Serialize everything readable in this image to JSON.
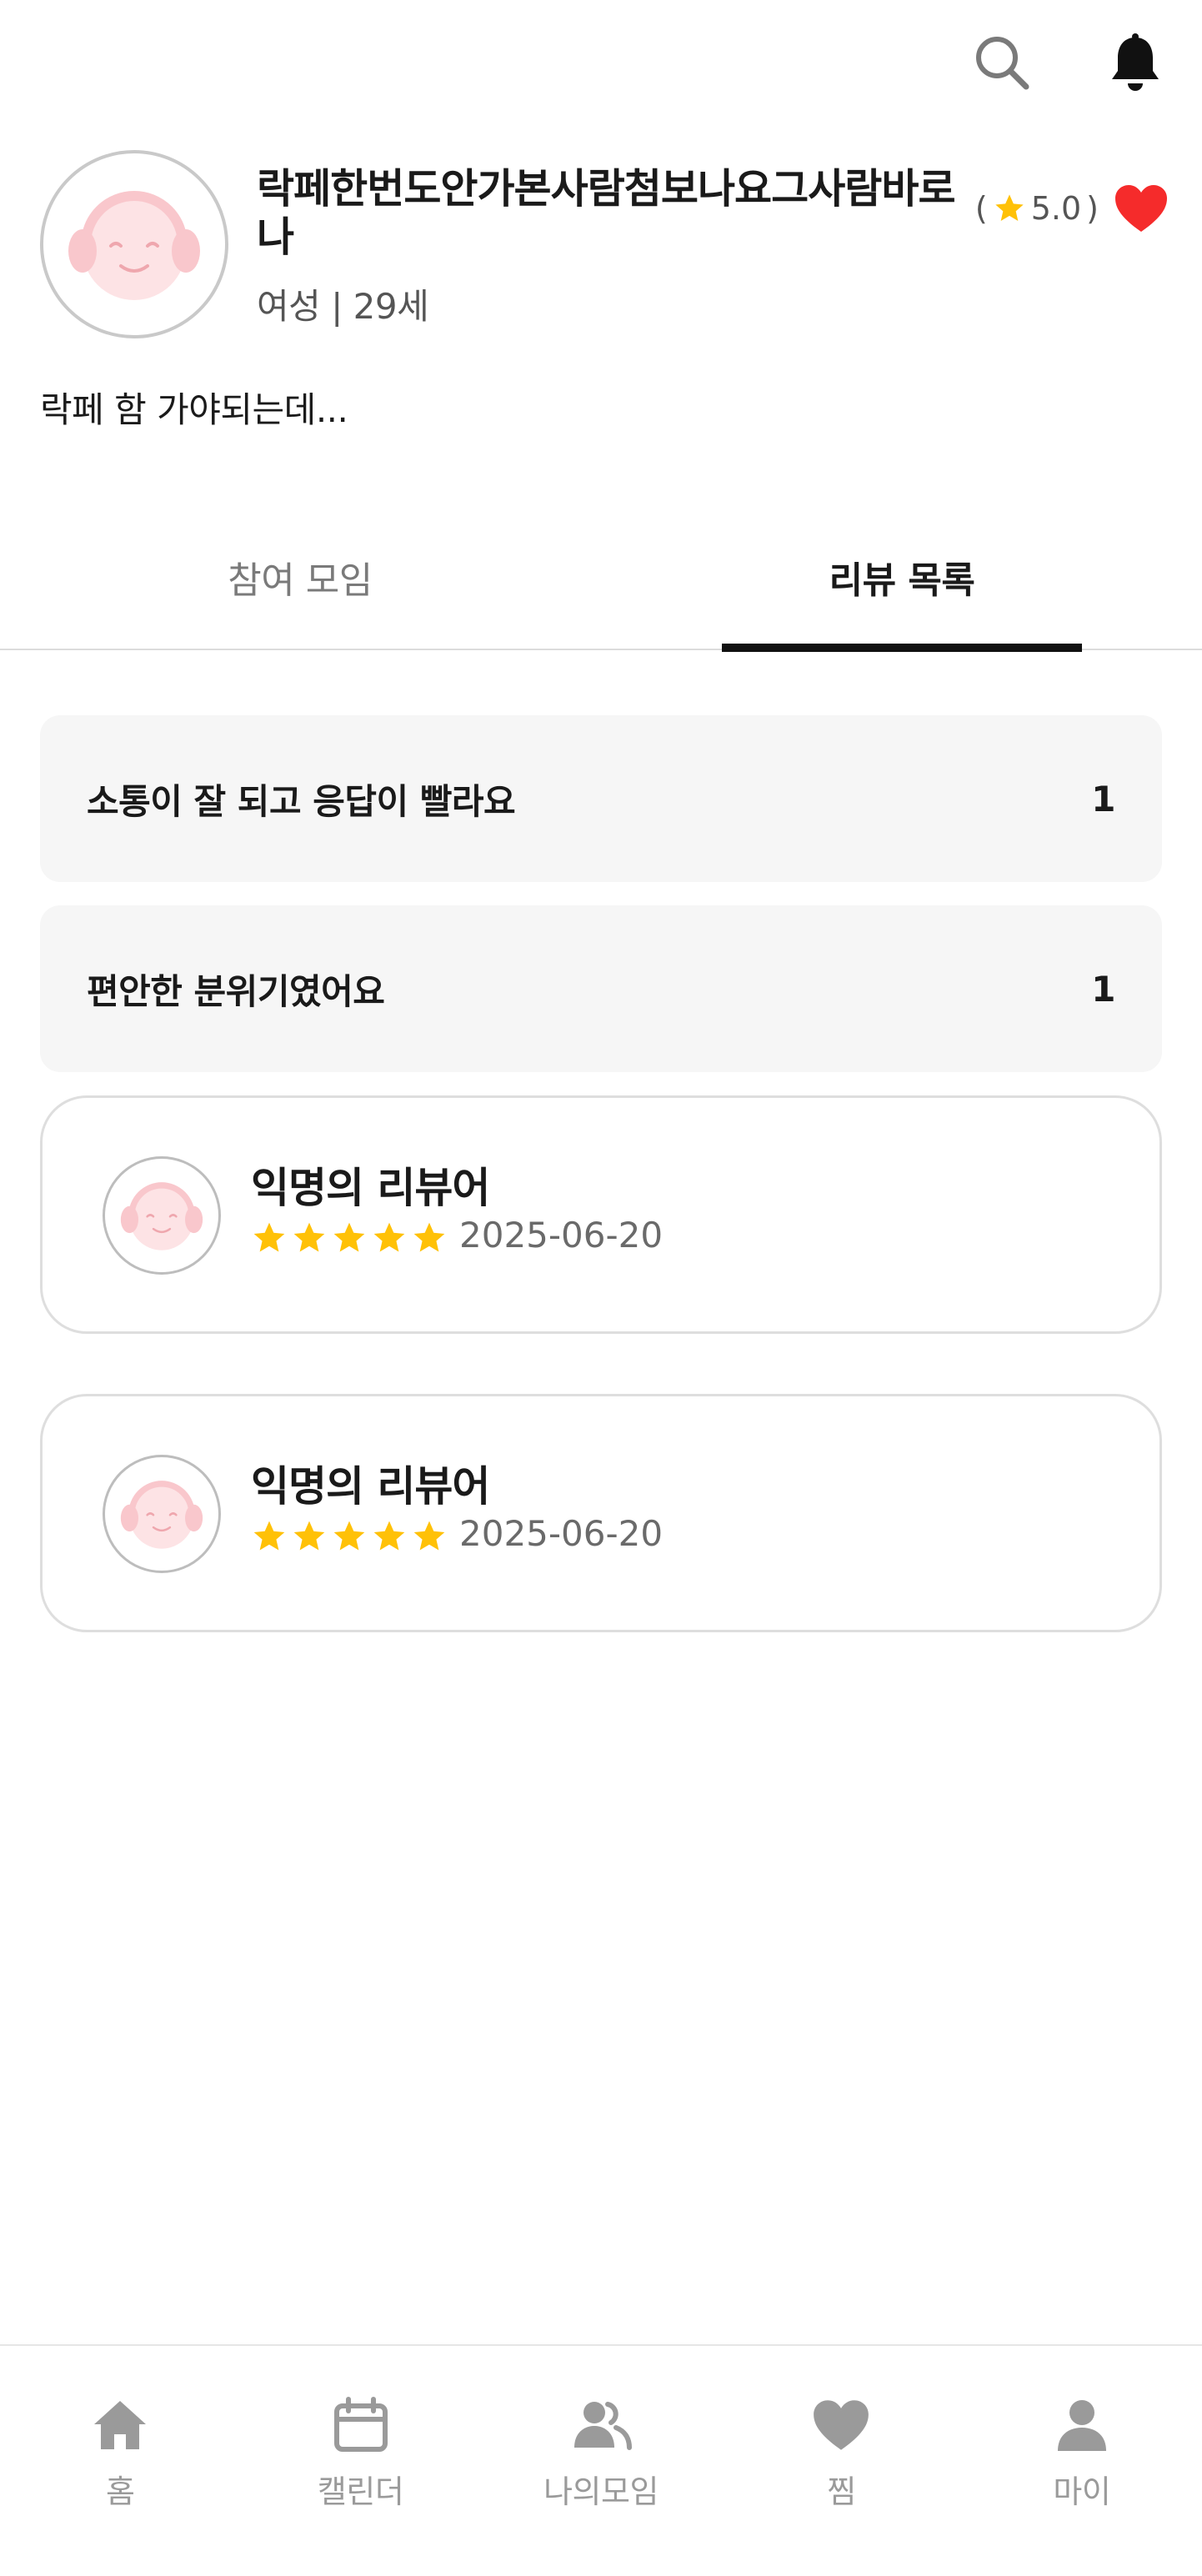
{
  "topbar": {
    "icons": [
      "search-icon",
      "bell-icon"
    ]
  },
  "profile": {
    "name": "락페한번도안가본사람첨보나요그사람바로나",
    "meta": "여성 | 29세",
    "rating_open": "(",
    "rating": "5.0",
    "rating_close": ")",
    "bio": "락페 함 가야되는데..."
  },
  "tabs": [
    {
      "label": "참여 모임",
      "active": false
    },
    {
      "label": "리뷰 목록",
      "active": true
    }
  ],
  "keywords": [
    {
      "label": "소통이 잘 되고 응답이 빨라요",
      "count": "1"
    },
    {
      "label": "편안한 분위기였어요",
      "count": "1"
    }
  ],
  "reviews": [
    {
      "name": "익명의 리뷰어",
      "stars": 5,
      "date": "2025-06-20"
    },
    {
      "name": "익명의 리뷰어",
      "stars": 5,
      "date": "2025-06-20"
    }
  ],
  "bottom_nav": [
    {
      "label": "홈",
      "icon": "home-icon"
    },
    {
      "label": "캘린더",
      "icon": "calendar-icon"
    },
    {
      "label": "나의모임",
      "icon": "group-icon"
    },
    {
      "label": "찜",
      "icon": "heart-icon"
    },
    {
      "label": "마이",
      "icon": "person-icon"
    }
  ],
  "colors": {
    "star": "#FFC107",
    "heart": "#F52B2B",
    "avatar_pink": "#F9C7CC",
    "nav_icon": "#9A9A9A"
  }
}
